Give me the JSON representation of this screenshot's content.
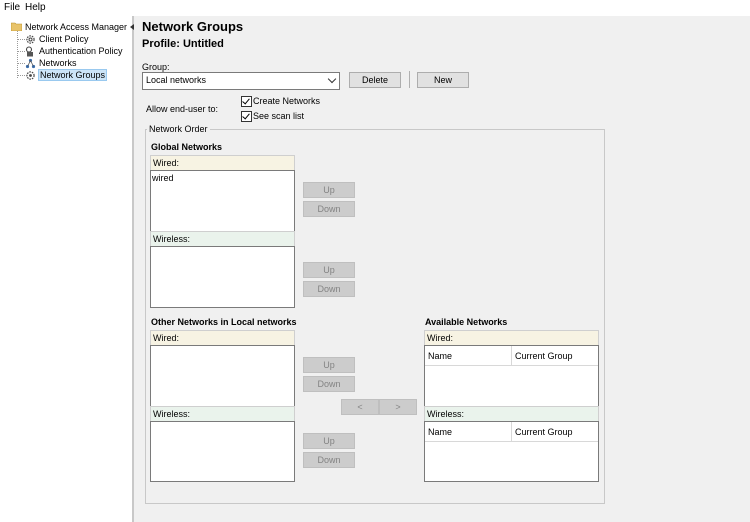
{
  "menu": {
    "file": "File",
    "help": "Help"
  },
  "tree": {
    "root": "Network Access Manager",
    "items": [
      {
        "label": "Client Policy"
      },
      {
        "label": "Authentication Policy"
      },
      {
        "label": "Networks"
      },
      {
        "label": "Network Groups"
      }
    ]
  },
  "main": {
    "title": "Network Groups",
    "profile": "Profile:  Untitled",
    "group_label": "Group:",
    "group_value": "Local networks",
    "delete_label": "Delete",
    "new_label": "New",
    "allow_label": "Allow end-user to:",
    "checkboxes": [
      {
        "label": "Create Networks",
        "checked": true
      },
      {
        "label": "See scan list",
        "checked": true
      }
    ],
    "network_order_title": "Network Order",
    "global": {
      "title": "Global Networks",
      "wired_header": "Wired:",
      "wired_items": [
        "wired"
      ],
      "wireless_header": "Wireless:"
    },
    "other": {
      "title": "Other Networks in Local networks",
      "wired_header": "Wired:",
      "wireless_header": "Wireless:"
    },
    "available": {
      "title": "Available Networks",
      "wired_header": "Wired:",
      "wireless_header": "Wireless:",
      "col_name": "Name",
      "col_group": "Current Group"
    },
    "up_label": "Up",
    "down_label": "Down",
    "left_label": "<",
    "right_label": ">"
  }
}
